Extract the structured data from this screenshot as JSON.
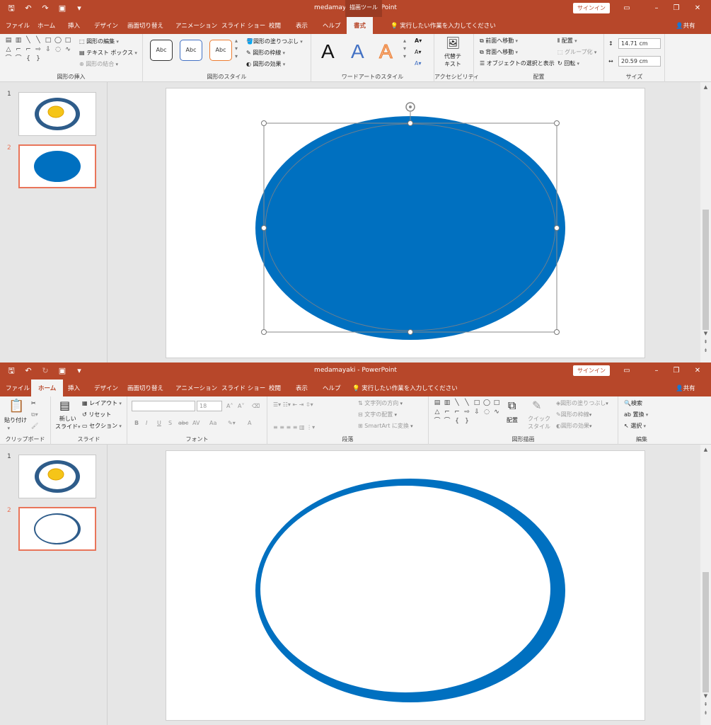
{
  "window1": {
    "title": "medamayaki  -  PowerPoint",
    "context_tab": "描画ツール",
    "signin": "サインイン",
    "tabs": [
      "ファイル",
      "ホーム",
      "挿入",
      "デザイン",
      "画面切り替え",
      "アニメーション",
      "スライド ショー",
      "校閲",
      "表示",
      "ヘルプ",
      "書式"
    ],
    "active_tab": "書式",
    "tellme": "実行したい作業を入力してください",
    "share": "共有",
    "ribbon": {
      "insert_shapes": {
        "label": "図形の挿入",
        "edit_shape": "図形の編集",
        "text_box": "テキスト ボックス",
        "merge_shapes": "図形の結合"
      },
      "shape_styles": {
        "label": "図形のスタイル",
        "swatch": "Abc",
        "fill": "図形の塗りつぶし",
        "outline": "図形の枠線",
        "effects": "図形の効果"
      },
      "wordart": {
        "label": "ワードアートのスタイル",
        "glyph": "A"
      },
      "accessibility": {
        "label": "アクセシビリティ",
        "alt_text_1": "代替テ",
        "alt_text_2": "キスト"
      },
      "arrange": {
        "label": "配置",
        "bring_forward": "前面へ移動",
        "send_backward": "背面へ移動",
        "selection_pane": "オブジェクトの選択と表示",
        "align": "配置",
        "group": "グループ化",
        "rotate": "回転"
      },
      "size": {
        "label": "サイズ",
        "height": "14.71 cm",
        "width": "20.59 cm"
      }
    },
    "slide_numbers": [
      "1",
      "2"
    ]
  },
  "window2": {
    "title": "medamayaki  -  PowerPoint",
    "signin": "サインイン",
    "tabs": [
      "ファイル",
      "ホーム",
      "挿入",
      "デザイン",
      "画面切り替え",
      "アニメーション",
      "スライド ショー",
      "校閲",
      "表示",
      "ヘルプ"
    ],
    "active_tab": "ホーム",
    "tellme": "実行したい作業を入力してください",
    "share": "共有",
    "ribbon": {
      "clipboard": {
        "label": "クリップボード",
        "paste": "貼り付け"
      },
      "slides": {
        "label": "スライド",
        "new_slide_1": "新しい",
        "new_slide_2": "スライド",
        "layout": "レイアウト",
        "reset": "リセット",
        "section": "セクション"
      },
      "font": {
        "label": "フォント",
        "size": "18",
        "bold": "B",
        "italic": "I",
        "underline": "U",
        "strike": "S",
        "abc": "abc",
        "av": "AV",
        "aa": "Aa",
        "a": "A"
      },
      "paragraph": {
        "label": "段落",
        "text_direction": "文字列の方向",
        "align_text": "文字の配置",
        "smartart": "SmartArt に変換"
      },
      "drawing": {
        "label": "図形描画",
        "arrange": "配置",
        "quick_styles_1": "クイック",
        "quick_styles_2": "スタイル",
        "fill": "図形の塗りつぶし",
        "outline": "図形の枠線",
        "effects": "図形の効果"
      },
      "editing": {
        "label": "編集",
        "find": "検索",
        "replace": "置換",
        "select": "選択"
      }
    },
    "slide_numbers": [
      "1",
      "2"
    ]
  },
  "colors": {
    "title_bar": "#b7472a",
    "shape_fill": "#0070c0",
    "shape_outline": "#2f5597",
    "yolk": "#f5c518",
    "selection": "#e9755a"
  }
}
